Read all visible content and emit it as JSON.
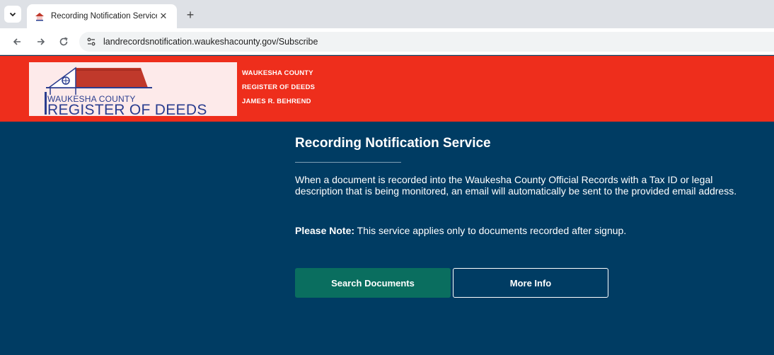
{
  "browser": {
    "tab": {
      "title": "Recording Notification Service",
      "close_glyph": "✕"
    },
    "new_tab_glyph": "+",
    "url": "landrecordsnotification.waukeshacounty.gov/Subscribe",
    "icons": [
      "chevron-down-icon",
      "house-favicon-icon",
      "back-arrow-icon",
      "forward-arrow-icon",
      "reload-icon",
      "site-settings-icon"
    ]
  },
  "header": {
    "logo": {
      "line1": "WAUKESHA COUNTY",
      "line2": "REGISTER OF DEEDS"
    },
    "lines": [
      "WAUKESHA COUNTY",
      "REGISTER OF DEEDS",
      "JAMES R. BEHREND"
    ],
    "colors": {
      "header_bg": "#ee2e1c",
      "logo_bg": "#fdeaea",
      "logo_text": "#2a3d8f",
      "roof": "#c0392b"
    }
  },
  "main": {
    "title": "Recording Notification Service",
    "description": "When a document is recorded into the Waukesha County Official Records with a Tax ID or legal description that is being monitored, an email will automatically be sent to the provided email address.",
    "note_label": "Please Note:",
    "note_text": " This service applies only to documents recorded after signup.",
    "buttons": {
      "search": "Search Documents",
      "info": "More Info"
    },
    "colors": {
      "background": "#003c63",
      "search_button": "#0a6e5f"
    }
  }
}
